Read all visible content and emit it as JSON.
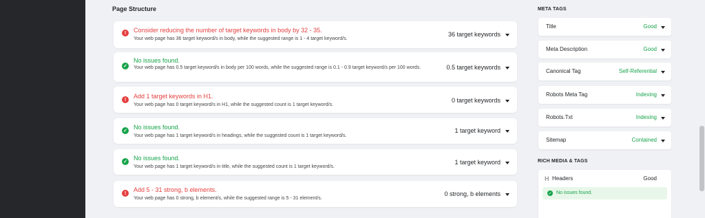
{
  "page": {
    "section_title": "Page Structure"
  },
  "checks": [
    {
      "status": "error",
      "title": "Consider reducing the number of target keywords in body by 32 - 35.",
      "desc": "Your web page has 36 target keyword/s in body, while the suggested range is 1 - 4 target keyword/s.",
      "value": "36 target keywords"
    },
    {
      "status": "ok",
      "title": "No issues found.",
      "desc": "Your web page has 0.5 target keyword/s in body per 100 words, while the suggested range is 0.1 - 0.9 target keyword/s per 100 words.",
      "value": "0.5 target keywords"
    },
    {
      "status": "error",
      "title": "Add 1 target keywords in H1.",
      "desc": "Your web page has 0 target keyword/s in H1, while the suggested count is 1 target keyword/s.",
      "value": "0 target keywords"
    },
    {
      "status": "ok",
      "title": "No issues found.",
      "desc": "Your web page has 1 target keyword/s in headings, while the suggested count is 1 target keyword/s.",
      "value": "1 target keyword"
    },
    {
      "status": "ok",
      "title": "No issues found.",
      "desc": "Your web page has 1 target keyword/s in title, while the suggested count is 1 target keyword/s.",
      "value": "1 target keyword"
    },
    {
      "status": "error",
      "title": "Add 5 - 31 strong, b elements.",
      "desc": "Your web page has 0 strong, b element/s, while the suggested range is 5 - 31 element/s.",
      "value": "0 strong, b elements"
    }
  ],
  "sidebar": {
    "meta_heading": "META TAGS",
    "meta_items": [
      {
        "label": "Title",
        "status": "Good"
      },
      {
        "label": "Meta Description",
        "status": "Good"
      },
      {
        "label": "Canonical Tag",
        "status": "Self-Referential"
      },
      {
        "label": "Robots Meta Tag",
        "status": "Indexing"
      },
      {
        "label": "Robots.Txt",
        "status": "Indexing"
      },
      {
        "label": "Sitemap",
        "status": "Contained"
      }
    ],
    "rich_heading": "RICH MEDIA & TAGS",
    "rich_item": {
      "icon": "header-icon",
      "icon_glyph": "H",
      "label": "Headers",
      "status": "Good",
      "note": "No issues found."
    }
  },
  "colors": {
    "error": "#e53e3e",
    "ok": "#16a34a",
    "rail": "#25272b",
    "background": "#f0f1f4"
  }
}
